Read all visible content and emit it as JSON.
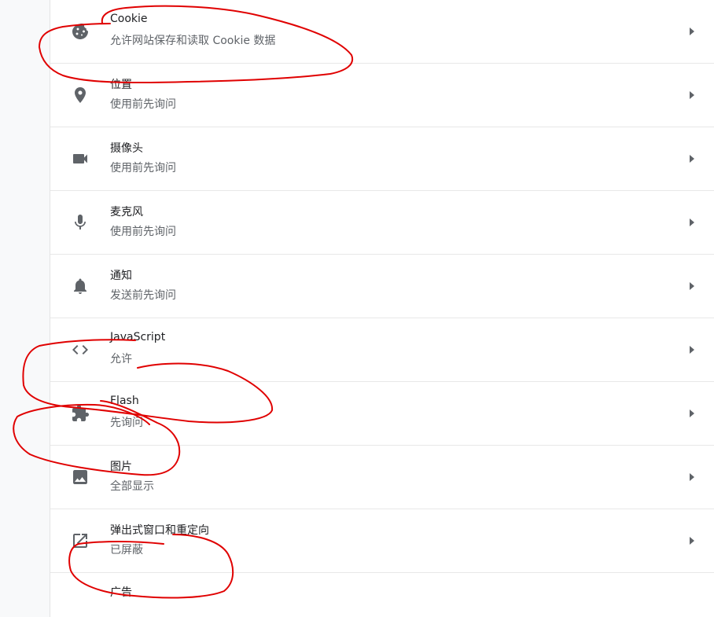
{
  "rows": [
    {
      "title": "Cookie",
      "subtitle": "允许网站保存和读取 Cookie 数据",
      "icon": "cookie-icon"
    },
    {
      "title": "位置",
      "subtitle": "使用前先询问",
      "icon": "location-icon"
    },
    {
      "title": "摄像头",
      "subtitle": "使用前先询问",
      "icon": "camera-icon"
    },
    {
      "title": "麦克风",
      "subtitle": "使用前先询问",
      "icon": "microphone-icon"
    },
    {
      "title": "通知",
      "subtitle": "发送前先询问",
      "icon": "bell-icon"
    },
    {
      "title": "JavaScript",
      "subtitle": "允许",
      "icon": "code-icon"
    },
    {
      "title": "Flash",
      "subtitle": "先询问",
      "icon": "puzzle-icon"
    },
    {
      "title": "图片",
      "subtitle": "全部显示",
      "icon": "image-icon"
    },
    {
      "title": "弹出式窗口和重定向",
      "subtitle": "已屏蔽",
      "icon": "open-in-new-icon"
    },
    {
      "title": "广告",
      "icon": "ad-icon"
    }
  ],
  "colors": {
    "title": "#202124",
    "subtitle": "#5f6368",
    "icon": "#5f6368",
    "divider": "#e8e8e8",
    "annotation": "#e00000"
  }
}
